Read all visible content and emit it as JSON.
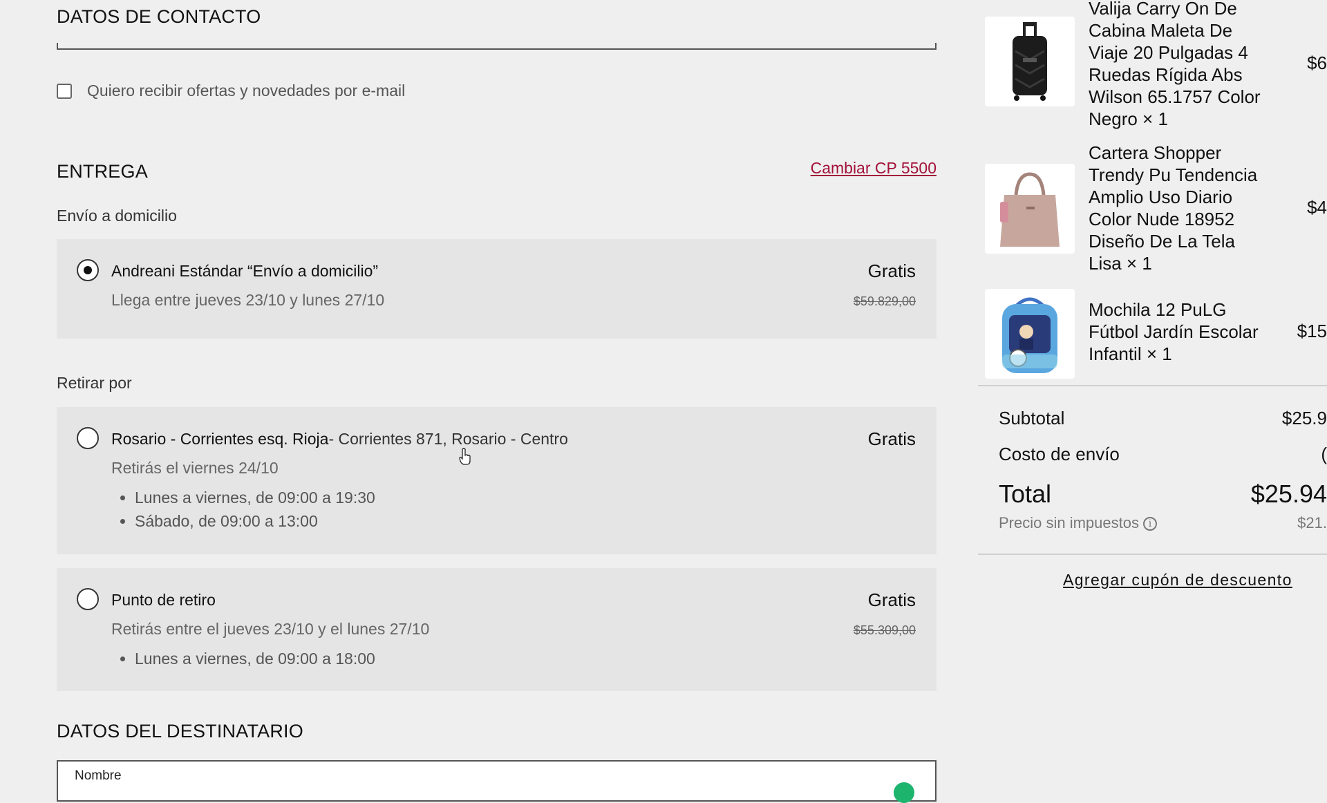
{
  "contact": {
    "title": "DATOS DE CONTACTO",
    "newsletter_label": "Quiero recibir ofertas y novedades por e-mail"
  },
  "delivery": {
    "title": "ENTREGA",
    "change_cp_label": "Cambiar CP 5500",
    "home_group_label": "Envío a domicilio",
    "home_option": {
      "title": "Andreani Estándar “Envío a domicilio”",
      "subtitle": "Llega entre jueves 23/10 y lunes 27/10",
      "price": "Gratis",
      "old_price": "$59.829,00"
    },
    "pickup_group_label": "Retirar por",
    "store_option": {
      "title": "Rosario - Corrientes esq. Rioja",
      "address": "- Corrientes 871, Rosario - Centro",
      "subtitle": "Retirás el viernes 24/10",
      "price": "Gratis",
      "hours": [
        "Lunes a viernes, de 09:00 a 19:30",
        "Sábado, de 09:00 a 13:00"
      ]
    },
    "point_option": {
      "title": "Punto de retiro",
      "subtitle": "Retirás entre el jueves 23/10 y el lunes 27/10",
      "price": "Gratis",
      "old_price": "$55.309,00",
      "hours": [
        "Lunes a viernes, de 09:00 a 18:00"
      ]
    }
  },
  "recipient": {
    "title": "DATOS DEL DESTINATARIO",
    "name_label": "Nombre"
  },
  "cart": {
    "items": [
      {
        "name": "Valija Carry On De Cabina Maleta De Viaje 20 Pulgadas 4 Ruedas Rígida Abs Wilson 65.1757 Color Negro × 1",
        "price": "$6",
        "image_icon": "suitcase-thumbnail"
      },
      {
        "name": "Cartera Shopper Trendy Pu Tendencia Amplio Uso Diario Color Nude 18952 Diseño De La Tela Lisa × 1",
        "price": "$4",
        "image_icon": "handbag-thumbnail"
      },
      {
        "name": "Mochila 12 PuLG Fútbol Jardín Escolar Infantil × 1",
        "price": "$15",
        "image_icon": "backpack-thumbnail"
      }
    ],
    "subtotal_label": "Subtotal",
    "subtotal_value": "$25.9",
    "shipping_label": "Costo de envío",
    "shipping_value": "(",
    "total_label": "Total",
    "total_value": "$25.94",
    "tax_label": "Precio sin impuestos",
    "tax_value": "$21.",
    "coupon_label": "Agregar cupón de descuento"
  },
  "colors": {
    "background": "#efefef",
    "option_bg": "#e5e5e5",
    "link": "#a3123a",
    "valid": "#1db46e"
  }
}
